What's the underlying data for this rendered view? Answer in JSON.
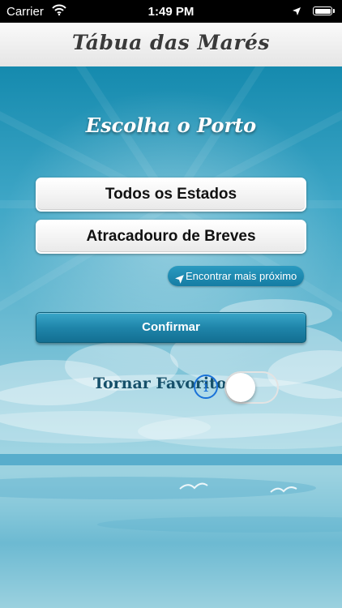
{
  "status_bar": {
    "carrier": "Carrier",
    "time": "1:49 PM"
  },
  "nav": {
    "title": "Tábua das Marés"
  },
  "main": {
    "heading": "Escolha o Porto",
    "state_selector": "Todos os Estados",
    "port_selector": "Atracadouro de Breves",
    "nearest_button": "Encontrar mais próximo",
    "confirm_button": "Confirmar",
    "favorite_label": "Tornar Favorito",
    "info_glyph": "i",
    "favorite_on": false
  },
  "colors": {
    "accent": "#1f85aa",
    "info_blue": "#1a72d8",
    "label_dark_blue": "#16506a"
  }
}
